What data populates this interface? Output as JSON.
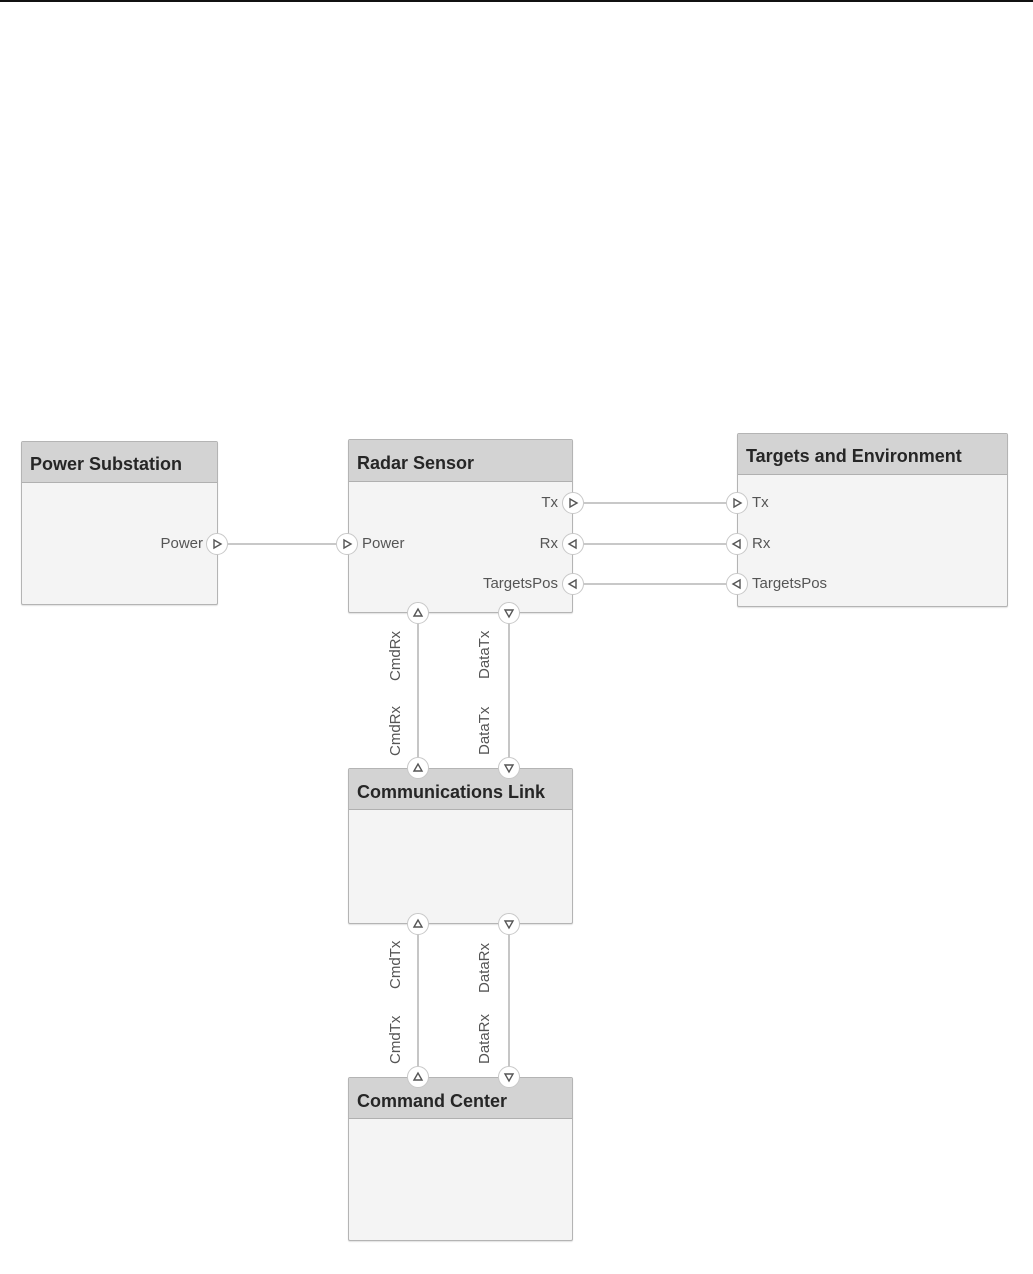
{
  "diagram": {
    "blocks": {
      "power_substation": {
        "title": "Power Substation",
        "ports": {
          "power": "Power"
        }
      },
      "radar_sensor": {
        "title": "Radar Sensor",
        "ports": {
          "power": "Power",
          "tx": "Tx",
          "rx": "Rx",
          "targets_pos": "TargetsPos",
          "cmd_rx": "CmdRx",
          "data_tx": "DataTx"
        }
      },
      "targets_environment": {
        "title": "Targets and Environment",
        "ports": {
          "tx": "Tx",
          "rx": "Rx",
          "targets_pos": "TargetsPos"
        }
      },
      "communications_link": {
        "title": "Communications Link",
        "ports": {
          "cmd_rx": "CmdRx",
          "data_tx": "DataTx",
          "cmd_tx": "CmdTx",
          "data_rx": "DataRx"
        }
      },
      "command_center": {
        "title": "Command Center",
        "ports": {
          "cmd_tx": "CmdTx",
          "data_rx": "DataRx"
        }
      }
    },
    "connections": [
      {
        "from": "Power Substation.Power",
        "to": "Radar Sensor.Power"
      },
      {
        "from": "Radar Sensor.Tx",
        "to": "Targets and Environment.Tx"
      },
      {
        "from": "Radar Sensor.Rx",
        "to": "Targets and Environment.Rx"
      },
      {
        "from": "Radar Sensor.TargetsPos",
        "to": "Targets and Environment.TargetsPos"
      },
      {
        "from": "Radar Sensor.CmdRx",
        "to": "Communications Link.CmdRx"
      },
      {
        "from": "Radar Sensor.DataTx",
        "to": "Communications Link.DataTx"
      },
      {
        "from": "Communications Link.CmdTx",
        "to": "Command Center.CmdTx"
      },
      {
        "from": "Communications Link.DataRx",
        "to": "Command Center.DataRx"
      }
    ],
    "colors": {
      "header": "#d3d3d3",
      "body": "#f4f4f4",
      "border": "#b4b4b4",
      "wire": "#a8a8a8",
      "label": "#555555"
    }
  }
}
